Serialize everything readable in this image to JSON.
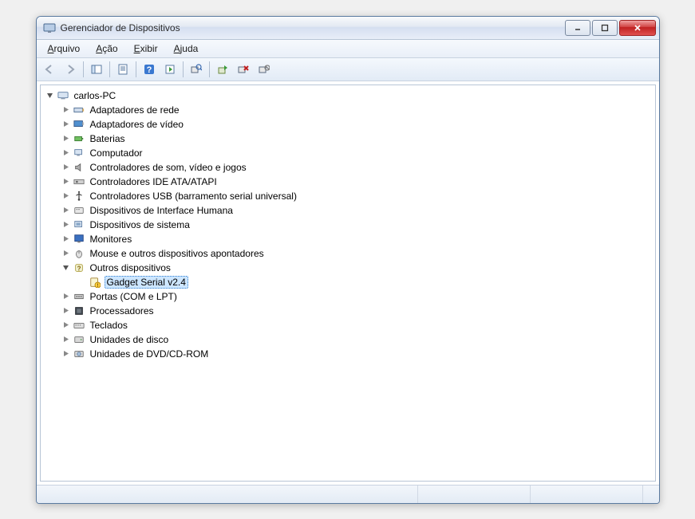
{
  "window": {
    "title": "Gerenciador de Dispositivos"
  },
  "menu": {
    "file": "Arquivo",
    "action": "Ação",
    "view": "Exibir",
    "help": "Ajuda"
  },
  "tree": {
    "root": "carlos-PC",
    "items": [
      {
        "label": "Adaptadores de rede",
        "icon": "network-adapter-icon"
      },
      {
        "label": "Adaptadores de vídeo",
        "icon": "display-adapter-icon"
      },
      {
        "label": "Baterias",
        "icon": "battery-icon"
      },
      {
        "label": "Computador",
        "icon": "computer-icon"
      },
      {
        "label": "Controladores de som, vídeo e jogos",
        "icon": "speaker-icon"
      },
      {
        "label": "Controladores IDE ATA/ATAPI",
        "icon": "ide-controller-icon"
      },
      {
        "label": "Controladores USB (barramento serial universal)",
        "icon": "usb-icon"
      },
      {
        "label": "Dispositivos de Interface Humana",
        "icon": "hid-icon"
      },
      {
        "label": "Dispositivos de sistema",
        "icon": "system-device-icon"
      },
      {
        "label": "Monitores",
        "icon": "monitor-icon"
      },
      {
        "label": "Mouse e outros dispositivos apontadores",
        "icon": "mouse-icon"
      },
      {
        "label": "Outros dispositivos",
        "icon": "unknown-device-icon",
        "expanded": true,
        "children": [
          {
            "label": "Gadget Serial v2.4",
            "icon": "warning-device-icon",
            "selected": true
          }
        ]
      },
      {
        "label": "Portas (COM e LPT)",
        "icon": "port-icon"
      },
      {
        "label": "Processadores",
        "icon": "processor-icon"
      },
      {
        "label": "Teclados",
        "icon": "keyboard-icon"
      },
      {
        "label": "Unidades de disco",
        "icon": "disk-icon"
      },
      {
        "label": "Unidades de DVD/CD-ROM",
        "icon": "optical-drive-icon"
      }
    ]
  }
}
